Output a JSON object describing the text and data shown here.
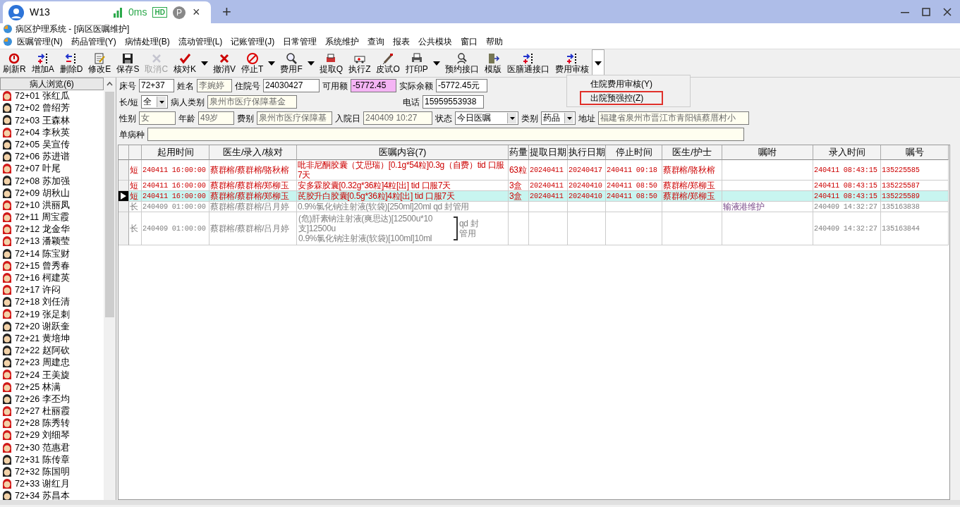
{
  "browser_tab": {
    "title": "W13",
    "latency": "0ms",
    "quality": "HD",
    "profile": "P",
    "close": "×",
    "new_tab": "+"
  },
  "window": {
    "title": "病区护理系统 - [病区医嘱维护]"
  },
  "menu": [
    "医嘱管理(N)",
    "药品管理(Y)",
    "病情处理(B)",
    "流动管理(L)",
    "记账管理(J)",
    "日常管理",
    "系统维护",
    "查询",
    "报表",
    "公共模块",
    "窗口",
    "帮助"
  ],
  "toolbar": [
    {
      "kind": "button",
      "label": "刷新R",
      "disabled": false
    },
    {
      "kind": "button",
      "label": "增加A",
      "disabled": false
    },
    {
      "kind": "button",
      "label": "删除D",
      "disabled": false
    },
    {
      "kind": "button",
      "label": "修改E",
      "disabled": false
    },
    {
      "kind": "button",
      "label": "保存S",
      "disabled": false
    },
    {
      "kind": "button",
      "label": "取消C",
      "disabled": true
    },
    {
      "kind": "button",
      "label": "核对K",
      "disabled": false
    },
    {
      "kind": "arrow",
      "open": false
    },
    {
      "kind": "button",
      "label": "撤消V",
      "disabled": false
    },
    {
      "kind": "button",
      "label": "停止T",
      "disabled": false
    },
    {
      "kind": "arrow",
      "open": false
    },
    {
      "kind": "button",
      "label": "费用F",
      "disabled": false
    },
    {
      "kind": "arrow",
      "open": false
    },
    {
      "kind": "button",
      "label": "提取Q",
      "disabled": false
    },
    {
      "kind": "button",
      "label": "执行Z",
      "disabled": false
    },
    {
      "kind": "button",
      "label": "皮试O",
      "disabled": false
    },
    {
      "kind": "button",
      "label": "打印P",
      "disabled": false
    },
    {
      "kind": "arrow",
      "open": false
    },
    {
      "kind": "button",
      "label": "预约接口",
      "disabled": false
    },
    {
      "kind": "button",
      "label": "模版",
      "disabled": false
    },
    {
      "kind": "button",
      "label": "医膳通接口",
      "disabled": false
    },
    {
      "kind": "button",
      "label": "费用审核",
      "disabled": false
    },
    {
      "kind": "arrow",
      "open": true
    }
  ],
  "dropdown_menu": [
    {
      "label": "住院费用审核(Y)",
      "marked": false
    },
    {
      "label": "出院预强控(Z)",
      "marked": true
    }
  ],
  "patient_list": {
    "title": "病人浏览(6)",
    "items": [
      {
        "bed": "72+01",
        "name": "张红瓜",
        "kind": "female"
      },
      {
        "bed": "72+02",
        "name": "曾绍芳",
        "kind": "male"
      },
      {
        "bed": "72+03",
        "name": "王森林",
        "kind": "male"
      },
      {
        "bed": "72+04",
        "name": "李秋英",
        "kind": "female"
      },
      {
        "bed": "72+05",
        "name": "吴宣传",
        "kind": "male"
      },
      {
        "bed": "72+06",
        "name": "苏进谱",
        "kind": "male"
      },
      {
        "bed": "72+07",
        "name": "叶尾",
        "kind": "female"
      },
      {
        "bed": "72+08",
        "name": "苏加强",
        "kind": "male"
      },
      {
        "bed": "72+09",
        "name": "胡秋山",
        "kind": "male"
      },
      {
        "bed": "72+10",
        "name": "洪丽凤",
        "kind": "female"
      },
      {
        "bed": "72+11",
        "name": "周宝霞",
        "kind": "female"
      },
      {
        "bed": "72+12",
        "name": "龙金华",
        "kind": "female"
      },
      {
        "bed": "72+13",
        "name": "潘颖莹",
        "kind": "female"
      },
      {
        "bed": "72+14",
        "name": "陈宝财",
        "kind": "male"
      },
      {
        "bed": "72+15",
        "name": "曾秀春",
        "kind": "female"
      },
      {
        "bed": "72+16",
        "name": "柯建英",
        "kind": "female"
      },
      {
        "bed": "72+17",
        "name": "许闷",
        "kind": "female"
      },
      {
        "bed": "72+18",
        "name": "刘任清",
        "kind": "male"
      },
      {
        "bed": "72+19",
        "name": "张足刺",
        "kind": "female"
      },
      {
        "bed": "72+20",
        "name": "谢跃奎",
        "kind": "male"
      },
      {
        "bed": "72+21",
        "name": "黄培坤",
        "kind": "male"
      },
      {
        "bed": "72+22",
        "name": "赵阿砍",
        "kind": "male"
      },
      {
        "bed": "72+23",
        "name": "周建忠",
        "kind": "male"
      },
      {
        "bed": "72+24",
        "name": "王美旋",
        "kind": "female"
      },
      {
        "bed": "72+25",
        "name": "林满",
        "kind": "female"
      },
      {
        "bed": "72+26",
        "name": "李丕均",
        "kind": "male"
      },
      {
        "bed": "72+27",
        "name": "杜丽霞",
        "kind": "female"
      },
      {
        "bed": "72+28",
        "name": "陈秀转",
        "kind": "female"
      },
      {
        "bed": "72+29",
        "name": "刘细琴",
        "kind": "female"
      },
      {
        "bed": "72+30",
        "name": "范惠君",
        "kind": "female"
      },
      {
        "bed": "72+31",
        "name": "陈传章",
        "kind": "male"
      },
      {
        "bed": "72+32",
        "name": "陈国明",
        "kind": "male"
      },
      {
        "bed": "72+33",
        "name": "谢红月",
        "kind": "female"
      },
      {
        "bed": "72+34",
        "name": "苏昌本",
        "kind": "male"
      }
    ]
  },
  "form": [
    [
      {
        "label": "床号",
        "value": "72+37",
        "kind": "text",
        "readonly": false,
        "highlight": false
      },
      {
        "label": "姓名",
        "value": "李婉婷",
        "kind": "text",
        "readonly": true,
        "highlight": false
      },
      {
        "label": "住院号",
        "value": "24030427",
        "kind": "text",
        "readonly": false,
        "highlight": false
      },
      {
        "label": "可用额",
        "value": "-5772.45",
        "kind": "text",
        "readonly": false,
        "highlight": true
      },
      {
        "label": "实际余额",
        "value": "-5772.45元",
        "kind": "text",
        "readonly": false,
        "highlight": false
      }
    ],
    [
      {
        "label": "长/短",
        "value": "全",
        "kind": "select",
        "readonly": false,
        "highlight": false
      },
      {
        "label": "病人类别",
        "value": "泉州市医疗保障基金",
        "kind": "text",
        "readonly": true,
        "highlight": false
      },
      {
        "label": "电话",
        "value": "15959553938",
        "kind": "text",
        "readonly": false,
        "highlight": false
      }
    ],
    [
      {
        "label": "性别",
        "value": "女",
        "kind": "text",
        "readonly": true,
        "highlight": false
      },
      {
        "label": "年龄",
        "value": "49岁",
        "kind": "text",
        "readonly": true,
        "highlight": false
      },
      {
        "label": "费别",
        "value": "泉州市医疗保障基",
        "kind": "text",
        "readonly": true,
        "highlight": false
      },
      {
        "label": "入院日",
        "value": "240409 10:27",
        "kind": "text",
        "readonly": true,
        "highlight": false
      },
      {
        "label": "状态",
        "value": "今日医嘱",
        "kind": "select",
        "readonly": false,
        "highlight": false
      },
      {
        "label": "类别",
        "value": "药品",
        "kind": "select",
        "readonly": false,
        "highlight": false
      },
      {
        "label": "地址",
        "value": "福建省泉州市晋江市青阳镇蔡厝村小",
        "kind": "text",
        "readonly": true,
        "highlight": false
      }
    ],
    [
      {
        "label": "单病种",
        "kind": "text",
        "readonly": true,
        "highlight": false
      }
    ]
  ],
  "orders": {
    "columns": [
      "起用时间",
      "医生/录入/核对",
      "医嘱内容(7)",
      "药量",
      "提取日期",
      "执行日期",
      "停止时间",
      "医生/护士",
      "嘱咐",
      "录入时间",
      "嘱号"
    ],
    "rows": [
      {
        "type": "短",
        "kind": "short",
        "selected": false,
        "cells": [
          "240411 16:00:00",
          "蔡群榕/蔡群榕/骆秋榕",
          "吡非尼酮胶囊（艾思瑞）[0.1g*54粒]0.3g（自费）tid 口服7天",
          "63粒",
          "20240411",
          "20240417",
          "240411 09:18",
          "蔡群榕/骆秋榕",
          null,
          "240411 08:43:15",
          "135225585"
        ]
      },
      {
        "type": "短",
        "kind": "short",
        "selected": false,
        "cells": [
          "240411 16:00:00",
          "蔡群榕/蔡群榕/郑柳玉",
          "安多霖胶囊[0.32g*36粒]4粒[出] tid 口服7天",
          "3盒",
          "20240411",
          "20240410",
          "240411 08:50",
          "蔡群榕/郑柳玉",
          null,
          "240411 08:43:15",
          "135225587"
        ]
      },
      {
        "type": "短",
        "kind": "short",
        "selected": true,
        "cells": [
          "240411 16:00:00",
          "蔡群榕/蔡群榕/郑柳玉",
          "芪胶升白胶囊[0.5g*36粒]4粒[出] tid 口服7天",
          "3盒",
          "20240411",
          "20240410",
          "240411 08:50",
          "蔡群榕/郑柳玉",
          null,
          "240411 08:43:15",
          "135225589"
        ]
      },
      {
        "type": "长",
        "kind": "long",
        "selected": false,
        "cells": [
          "240409 01:00:00",
          "蔡群榕/蔡群榕/吕月婷",
          "0.9%氯化钠注射液(软袋)[250ml]20ml qd 封管用",
          null,
          null,
          null,
          null,
          null,
          "输液港维护",
          "240409 14:32:27",
          "135163838"
        ]
      },
      {
        "type": "长",
        "kind": "long",
        "selected": false,
        "cells": [
          "240409 01:00:00",
          "蔡群榕/蔡群榕/吕月婷",
          {
            "lines": [
              "(危)肝素钠注射液(爽思达)[12500u*10支]12500u",
              "0.9%氯化钠注射液(软袋)[100ml]10ml"
            ],
            "group_note": "qd 封管用"
          },
          null,
          null,
          null,
          null,
          null,
          null,
          "240409 14:32:27",
          "135163844"
        ]
      }
    ]
  }
}
